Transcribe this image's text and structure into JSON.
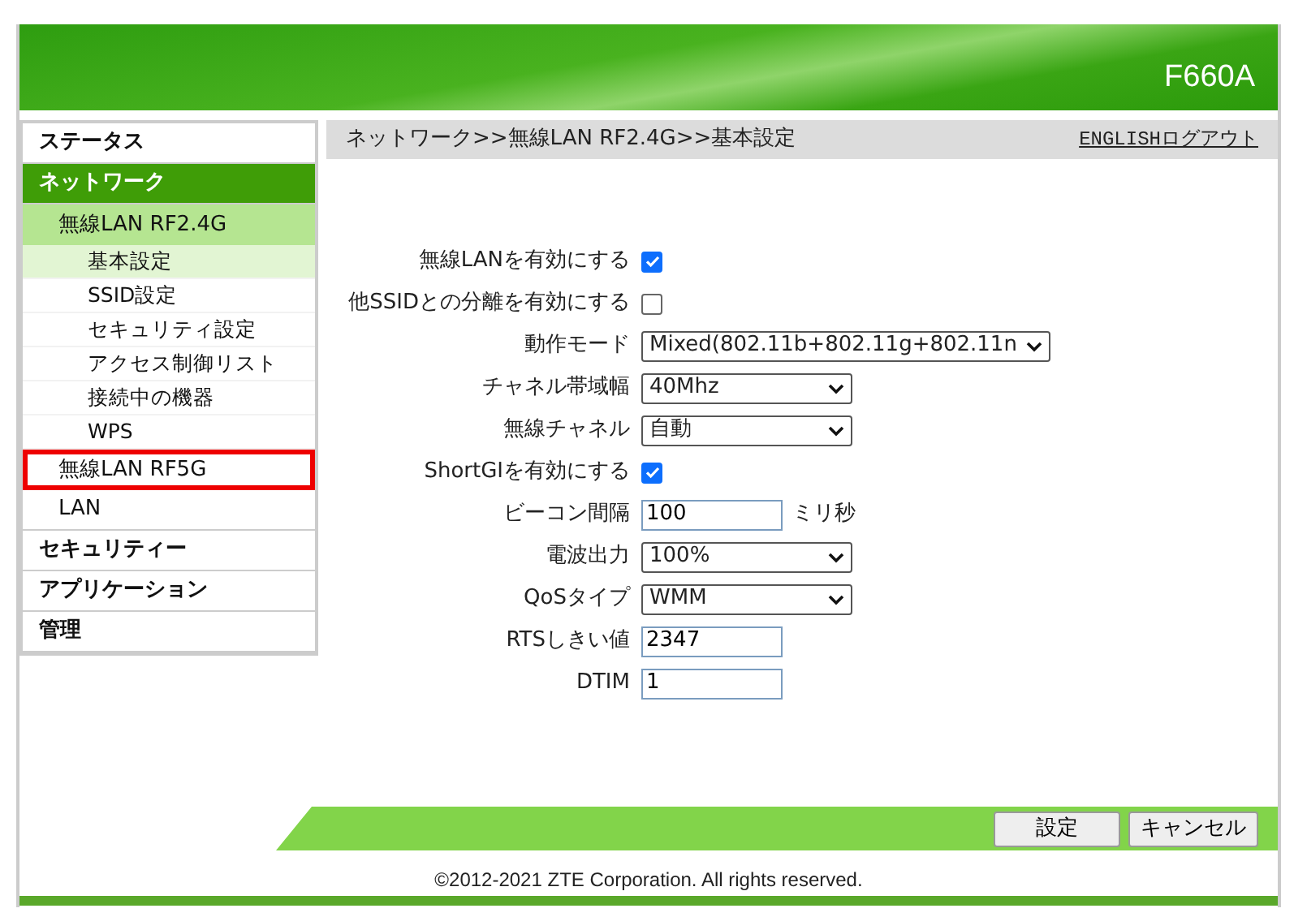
{
  "header": {
    "model": "F660A"
  },
  "sidebar": {
    "items": [
      {
        "label": "ステータス",
        "selected": false
      },
      {
        "label": "ネットワーク",
        "selected": true,
        "children": [
          {
            "label": "無線LAN RF2.4G",
            "selected": true,
            "highlighted": false,
            "children": [
              {
                "label": "基本設定",
                "selected": true
              },
              {
                "label": "SSID設定",
                "selected": false
              },
              {
                "label": "セキュリティ設定",
                "selected": false
              },
              {
                "label": "アクセス制御リスト",
                "selected": false
              },
              {
                "label": "接続中の機器",
                "selected": false
              },
              {
                "label": "WPS",
                "selected": false
              }
            ]
          },
          {
            "label": "無線LAN RF5G",
            "selected": false,
            "highlighted": true
          },
          {
            "label": "LAN",
            "selected": false,
            "highlighted": false
          }
        ]
      },
      {
        "label": "セキュリティー",
        "selected": false
      },
      {
        "label": "アプリケーション",
        "selected": false
      },
      {
        "label": "管理",
        "selected": false
      }
    ]
  },
  "breadcrumb": "ネットワーク>>無線LAN RF2.4G>>基本設定",
  "top_links": [
    "ENGLISH",
    "ログアウト"
  ],
  "form": [
    {
      "kind": "checkbox",
      "label": "無線LANを有効にする",
      "checked": true
    },
    {
      "kind": "checkbox",
      "label": "他SSIDとの分離を有効にする",
      "checked": false
    },
    {
      "kind": "select",
      "label": "動作モード",
      "value": "Mixed(802.11b+802.11g+802.11n"
    },
    {
      "kind": "select",
      "label": "チャネル帯域幅",
      "value": "40Mhz"
    },
    {
      "kind": "select",
      "label": "無線チャネル",
      "value": "自動"
    },
    {
      "kind": "checkbox",
      "label": "ShortGIを有効にする",
      "checked": true
    },
    {
      "kind": "text",
      "label": "ビーコン間隔",
      "value": "100",
      "unit": "ミリ秒"
    },
    {
      "kind": "select",
      "label": "電波出力",
      "value": "100%"
    },
    {
      "kind": "select",
      "label": "QoSタイプ",
      "value": "WMM"
    },
    {
      "kind": "text",
      "label": "RTSしきい値",
      "value": "2347"
    },
    {
      "kind": "text",
      "label": "DTIM",
      "value": "1"
    }
  ],
  "buttons": [
    "設定",
    "キャンセル"
  ],
  "copyright": "©2012-2021 ZTE Corporation. All rights reserved."
}
